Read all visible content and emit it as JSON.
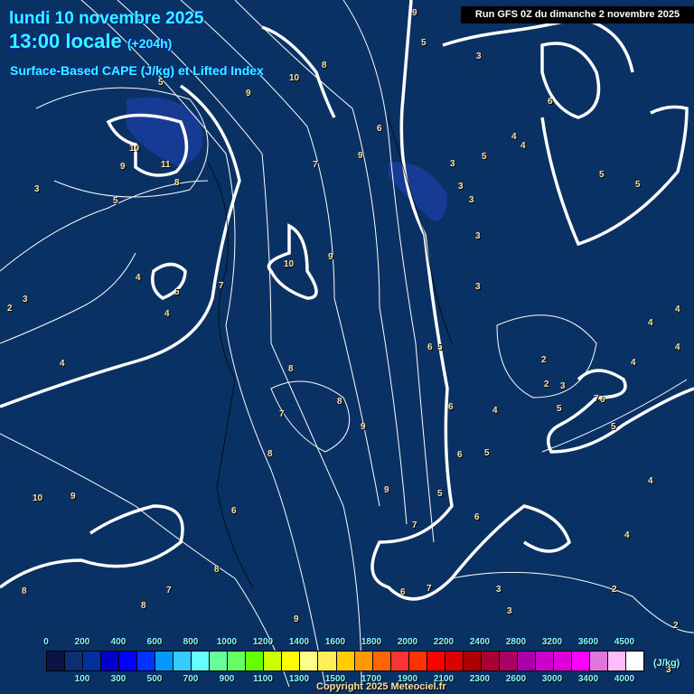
{
  "header": {
    "date": "lundi 10 novembre 2025",
    "time": "13:00 locale",
    "lead": "(+204h)",
    "parameter": "Surface-Based CAPE (J/kg) et Lifted Index",
    "run": "Run GFS 0Z du dimanche 2 novembre 2025"
  },
  "legend": {
    "unit": "(J/kg)",
    "top_labels": [
      "0",
      "200",
      "400",
      "600",
      "800",
      "1000",
      "1200",
      "1400",
      "1600",
      "1800",
      "2000",
      "2200",
      "2400",
      "2800",
      "3200",
      "3600",
      "4500"
    ],
    "bottom_labels": [
      "100",
      "300",
      "500",
      "700",
      "900",
      "1100",
      "1300",
      "1500",
      "1700",
      "1900",
      "2100",
      "2300",
      "2600",
      "3000",
      "3400",
      "4000"
    ],
    "colors": [
      "#0a1545",
      "#0a3070",
      "#00309c",
      "#0000cc",
      "#0000ff",
      "#0033ff",
      "#0099ff",
      "#33ccff",
      "#66ffff",
      "#66ff99",
      "#66ff66",
      "#66ff00",
      "#ccff00",
      "#ffff00",
      "#ffff88",
      "#ffee55",
      "#ffcc00",
      "#ff9900",
      "#ff6600",
      "#ff3333",
      "#ff3300",
      "#ff0000",
      "#dd0000",
      "#aa0000",
      "#aa0033",
      "#aa0066",
      "#aa00aa",
      "#cc00cc",
      "#dd00dd",
      "#ff00ff",
      "#dd77dd",
      "#ffbbff",
      "#ffffff"
    ]
  },
  "contour_labels": [
    "5",
    "10",
    "11",
    "9",
    "8",
    "3",
    "5",
    "9",
    "10",
    "8",
    "6",
    "7",
    "9",
    "3",
    "3",
    "3",
    "5",
    "4",
    "4",
    "6",
    "5",
    "5",
    "3",
    "3",
    "10",
    "9",
    "7",
    "4",
    "5",
    "4",
    "2",
    "3",
    "4",
    "6",
    "5",
    "8",
    "7",
    "8",
    "9",
    "6",
    "5",
    "6",
    "2",
    "2",
    "3",
    "5",
    "7",
    "6",
    "4",
    "5",
    "4",
    "4",
    "4",
    "8",
    "10",
    "9",
    "6",
    "8",
    "8",
    "7",
    "8",
    "9",
    "9",
    "6",
    "7",
    "6",
    "5",
    "3",
    "3",
    "4",
    "2",
    "2",
    "3",
    "4",
    "7",
    "5",
    "3",
    "9",
    "4"
  ],
  "copyright": "Copyright 2025 Meteociel.fr"
}
